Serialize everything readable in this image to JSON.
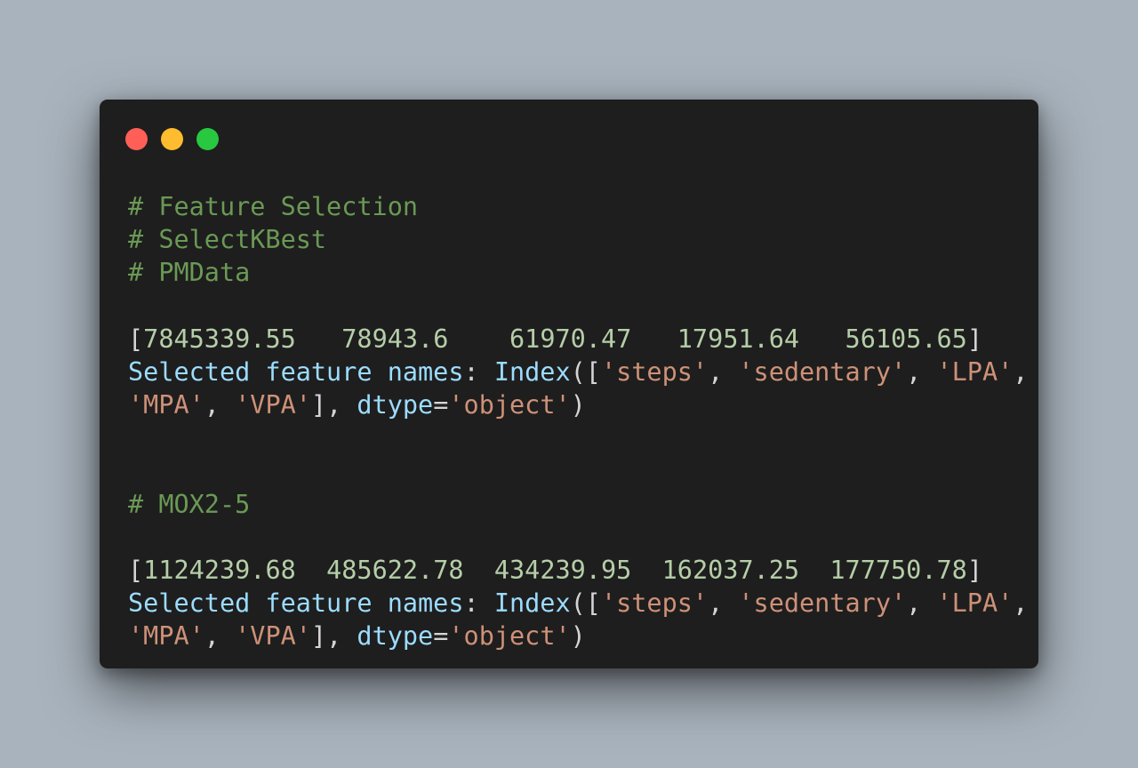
{
  "window": {
    "controls": {
      "close_color": "#ff5f57",
      "minimize_color": "#febc2e",
      "maximize_color": "#28c840"
    }
  },
  "code": {
    "block1": {
      "comments": [
        "# Feature Selection",
        "# SelectKBest",
        "# PMData"
      ],
      "array_open": "[",
      "scores": [
        "7845339.55",
        "78943.6",
        "61970.47",
        "17951.64",
        "56105.65"
      ],
      "array_close": "]",
      "label": "Selected feature names",
      "colon": ": ",
      "func": "Index",
      "open": "([",
      "features": [
        "'steps'",
        "'sedentary'",
        "'LPA'",
        "'MPA'",
        "'VPA'"
      ],
      "sep": ", ",
      "close_list": "], ",
      "dtype_key": "dtype",
      "eq": "=",
      "dtype_val": "'object'",
      "close": ")"
    },
    "block2": {
      "comments": [
        "# MOX2-5"
      ],
      "array_open": "[",
      "scores": [
        "1124239.68",
        "485622.78",
        "434239.95",
        "162037.25",
        "177750.78"
      ],
      "array_close": "]",
      "label": "Selected feature names",
      "colon": ": ",
      "func": "Index",
      "open": "([",
      "features": [
        "'steps'",
        "'sedentary'",
        "'LPA'",
        "'MPA'",
        "'VPA'"
      ],
      "sep": ", ",
      "close_list": "], ",
      "dtype_key": "dtype",
      "eq": "=",
      "dtype_val": "'object'",
      "close": ")"
    }
  }
}
